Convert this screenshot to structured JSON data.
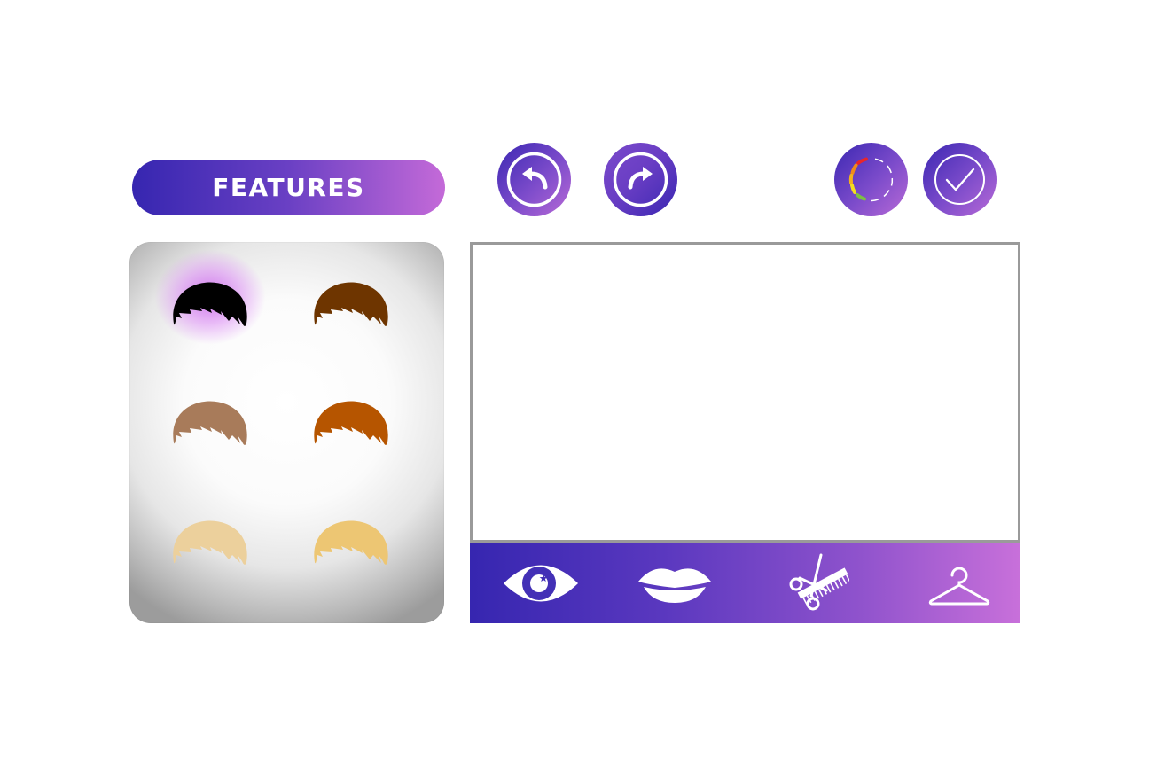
{
  "header": {
    "features_label": "FEATURES"
  },
  "toolbar_top": {
    "undo": {
      "icon": "undo-arrow-icon"
    },
    "redo": {
      "icon": "redo-arrow-icon"
    },
    "color_palette": {
      "icon": "color-wheel-icon"
    },
    "confirm": {
      "icon": "checkmark-icon"
    }
  },
  "hair_swatches": [
    {
      "name": "black",
      "color": "#000000",
      "selected": true
    },
    {
      "name": "dark-brown",
      "color": "#6e3500",
      "selected": false
    },
    {
      "name": "light-brown",
      "color": "#a87b5a",
      "selected": false
    },
    {
      "name": "auburn",
      "color": "#b65500",
      "selected": false
    },
    {
      "name": "light-blonde",
      "color": "#ecd09c",
      "selected": false
    },
    {
      "name": "golden-blonde",
      "color": "#edc673",
      "selected": false
    }
  ],
  "bottom_tools": [
    {
      "name": "eye",
      "icon": "eye-icon"
    },
    {
      "name": "lips",
      "icon": "lips-icon"
    },
    {
      "name": "hair",
      "icon": "scissors-comb-icon"
    },
    {
      "name": "clothes",
      "icon": "hanger-icon"
    }
  ],
  "colors": {
    "accent_start": "#3626b0",
    "accent_end": "#c870da",
    "glow": "#ce6eee"
  }
}
